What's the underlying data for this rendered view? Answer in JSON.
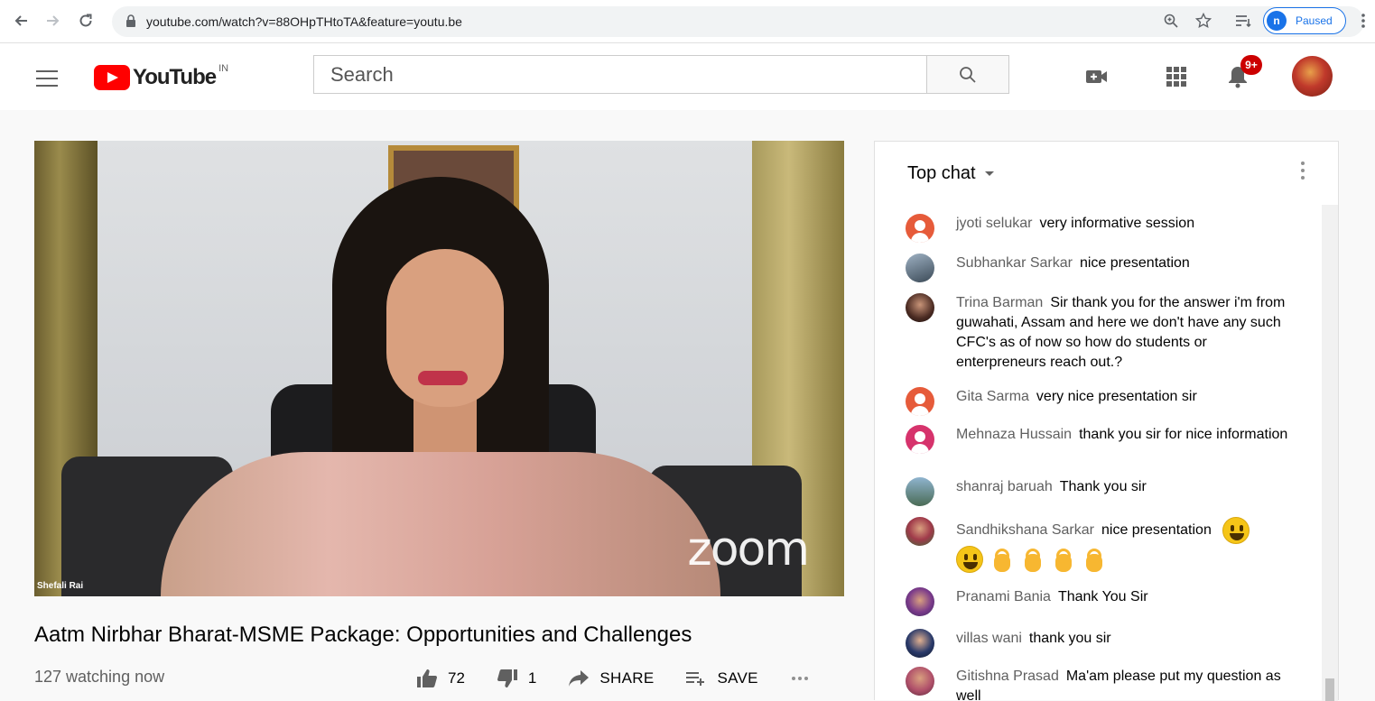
{
  "browser": {
    "url": "youtube.com/watch?v=88OHpTHtoTA&feature=youtu.be",
    "profile_initial": "n",
    "profile_status": "Paused"
  },
  "masthead": {
    "logo_text": "YouTube",
    "country_code": "IN",
    "search_placeholder": "Search",
    "notification_count": "9+"
  },
  "video": {
    "participant_name": "Shefali Rai",
    "watermark": "zoom",
    "title": "Aatm Nirbhar Bharat-MSME Package: Opportunities and Challenges",
    "watching": "127 watching now",
    "likes": "72",
    "dislikes": "1",
    "share_label": "SHARE",
    "save_label": "SAVE"
  },
  "chat": {
    "title": "Top chat",
    "messages": [
      {
        "author": "jyoti selukar",
        "text": "very informative session",
        "avatar": "default"
      },
      {
        "author": "Subhankar Sarkar",
        "text": "nice presentation",
        "avatar": "photo"
      },
      {
        "author": "Trina Barman",
        "text": "Sir thank you for the answer i'm from guwahati, Assam and here we don't have any such CFC's as of now so how do students or enterpreneurs reach out.?",
        "avatar": "photo"
      },
      {
        "author": "Gita Sarma",
        "text": "very nice presentation sir",
        "avatar": "default"
      },
      {
        "author": "Mehnaza Hussain",
        "text": "thank you sir for nice information",
        "avatar": "pink"
      },
      {
        "author": "shanraj baruah",
        "text": "Thank you sir",
        "avatar": "photo"
      },
      {
        "author": "Sandhikshana Sarkar",
        "text": "nice presentation",
        "avatar": "photo"
      },
      {
        "author": "Pranami Bania",
        "text": "Thank You Sir",
        "avatar": "photo"
      },
      {
        "author": "villas wani",
        "text": "thank you sir",
        "avatar": "photo"
      },
      {
        "author": "Gitishna Prasad",
        "text": "Ma'am please put my question as well",
        "avatar": "photo"
      }
    ]
  },
  "colors": {
    "brand_red": "#ff0000",
    "accent_blue": "#1a73e8",
    "badge_red": "#cc0000"
  }
}
